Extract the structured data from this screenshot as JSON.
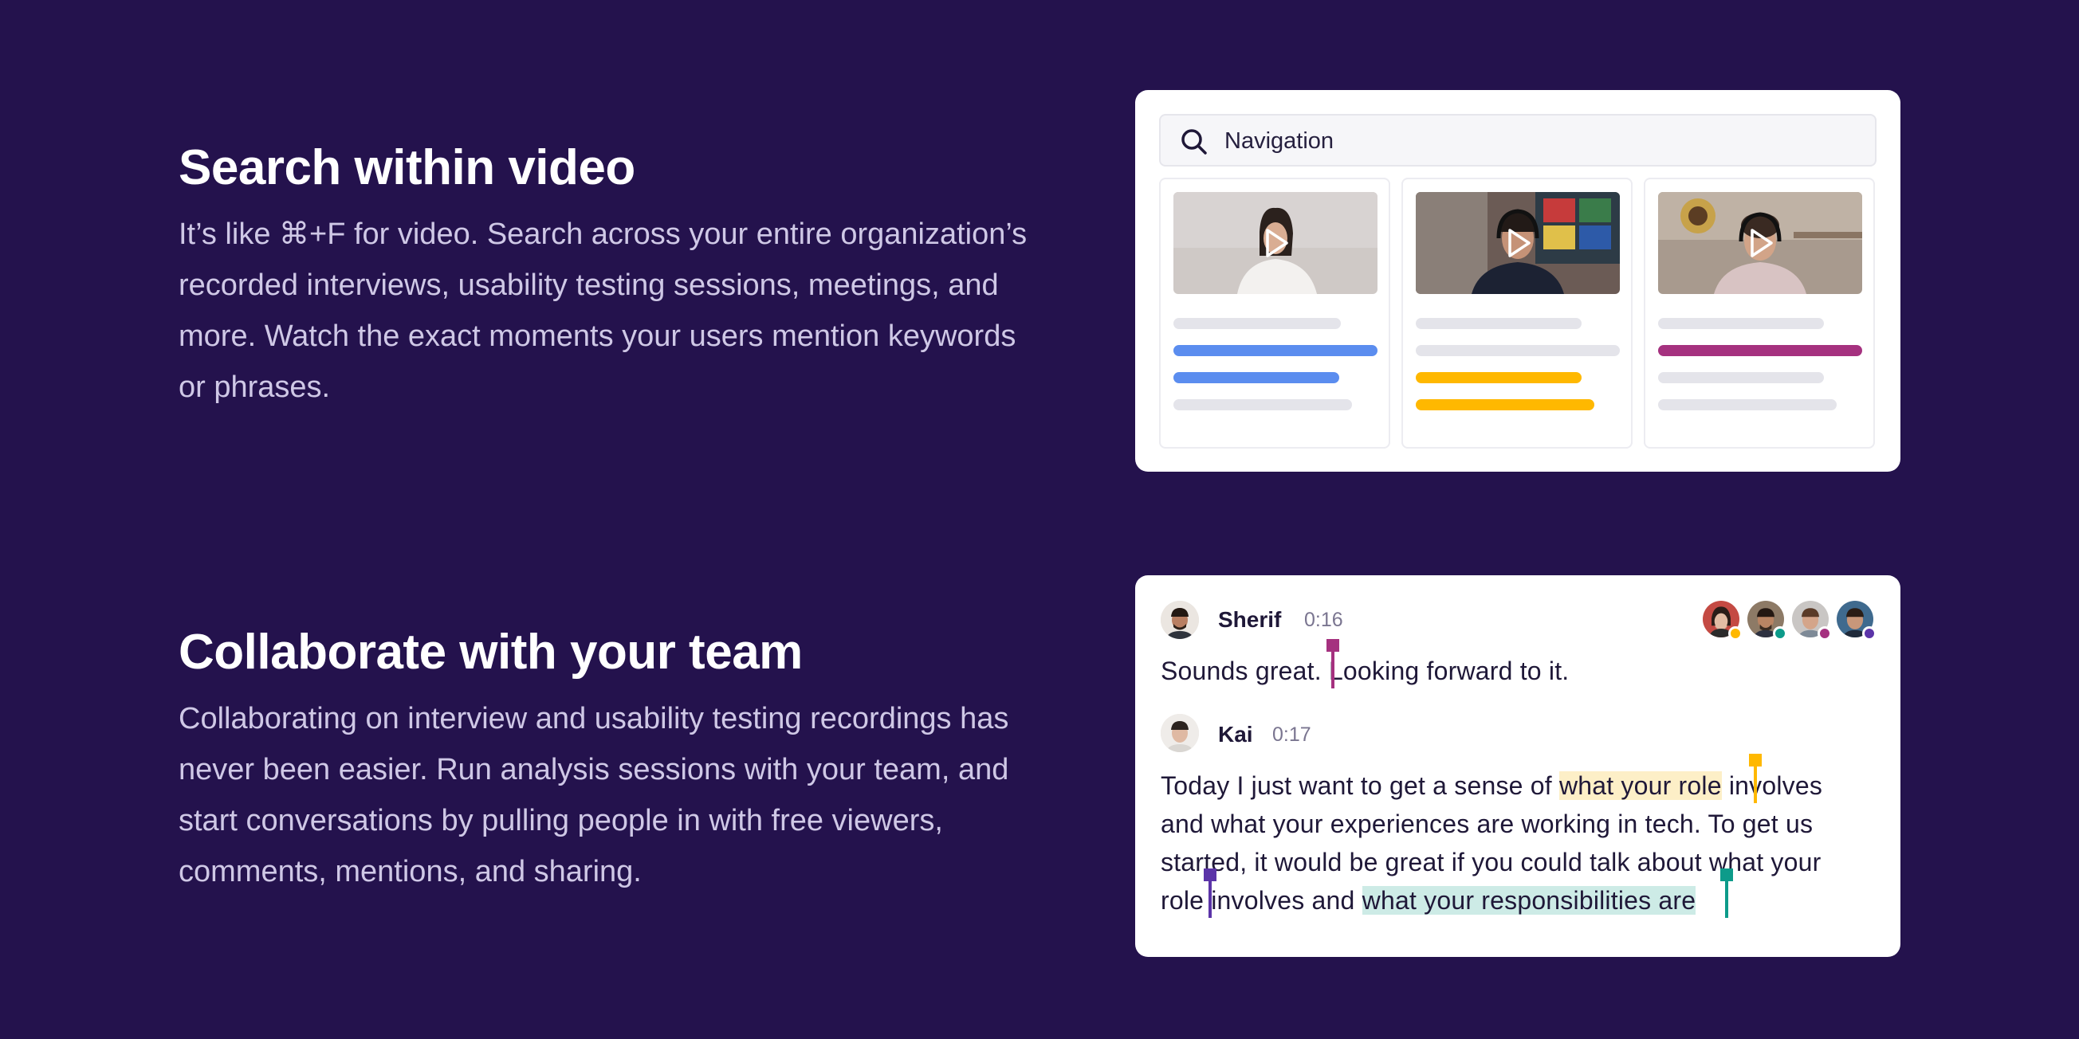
{
  "sections": [
    {
      "title": "Search within video",
      "body": "It’s like ⌘+F for video. Search across your entire organization’s recorded interviews, usability testing sessions, meetings, and more. Watch the exact moments your users mention keywords or phrases."
    },
    {
      "title": "Collaborate with your team",
      "body": "Collaborating on interview and usability testing recordings has never been easier. Run analysis sessions with your team, and start conversations by pulling people in with free viewers, comments, mentions, and sharing."
    }
  ],
  "search": {
    "query": "Navigation",
    "icon": "search-icon"
  },
  "results": [
    {
      "thumbnail": "video-thumbnail-woman",
      "accent": "#5b8def"
    },
    {
      "thumbnail": "video-thumbnail-man-headphones",
      "accent": "#ffb800"
    },
    {
      "thumbnail": "video-thumbnail-man-curly",
      "accent": "#a5317f"
    }
  ],
  "transcript": {
    "entries": [
      {
        "speaker": "Sherif",
        "time": "0:16",
        "lines": [
          "Sounds great. Looking forward to it."
        ]
      },
      {
        "speaker": "Kai",
        "time": "0:17",
        "lines": [
          {
            "before": "Today I just want to get a sense of ",
            "highlight": "what your role",
            "after": " involves"
          },
          "and what your experiences are working in tech. To get us",
          "started, it would be great if you could talk about what your",
          {
            "before": "role involves and ",
            "highlight": "what your responsibilities are",
            "after": ""
          }
        ]
      }
    ],
    "collaborators": [
      {
        "status_color": "#ffb800"
      },
      {
        "status_color": "#0d9b8a"
      },
      {
        "status_color": "#a5317f"
      },
      {
        "status_color": "#5b34a8"
      }
    ],
    "marker_colors": {
      "magenta": "#a5317f",
      "yellow": "#ffb800",
      "purple": "#5b34a8",
      "teal": "#0d9b8a"
    }
  }
}
